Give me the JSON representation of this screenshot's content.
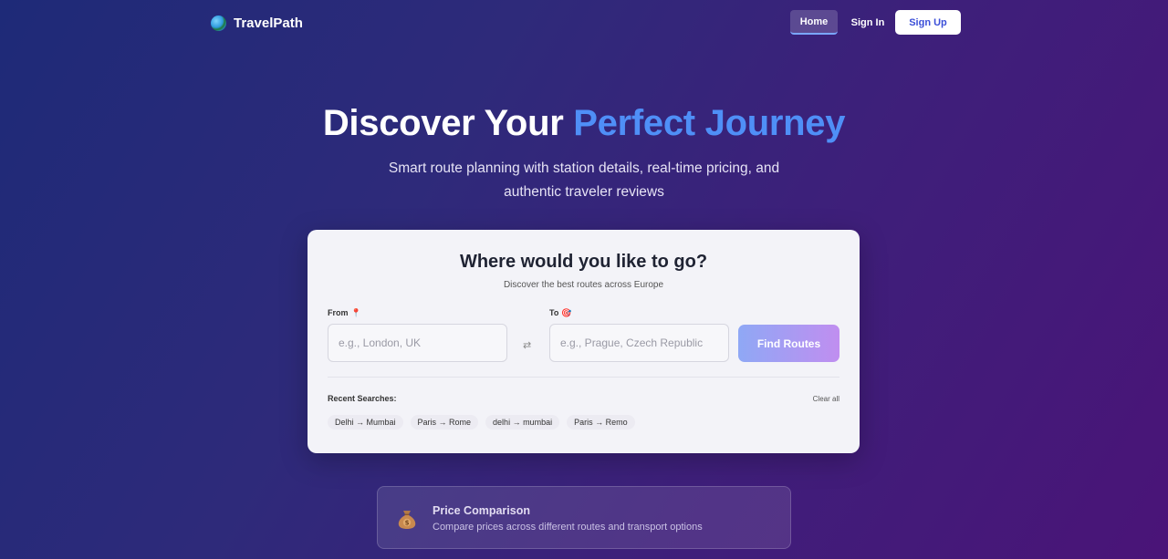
{
  "nav": {
    "brand": "TravelPath",
    "home": "Home",
    "sign_in": "Sign In",
    "sign_up": "Sign Up"
  },
  "hero": {
    "title_plain": "Discover Your",
    "title_accent": "Perfect Journey",
    "subtitle": "Smart route planning with station details, real-time pricing, and authentic traveler reviews"
  },
  "search": {
    "title": "Where would you like to go?",
    "subtitle": "Discover the best routes across Europe",
    "from_label": "From",
    "from_placeholder": "e.g., London, UK",
    "to_label": "To",
    "to_placeholder": "e.g., Prague, Czech Republic",
    "swap_icon": "⇄",
    "button": "Find Routes"
  },
  "recent": {
    "label": "Recent Searches:",
    "clear": "Clear all",
    "items": [
      "Delhi → Mumbai",
      "Paris → Rome",
      "delhi → mumbai",
      "Paris → Remo"
    ]
  },
  "feature": {
    "title": "Price Comparison",
    "description": "Compare prices across different routes and transport options",
    "icon": "money-bag-icon"
  },
  "colors": {
    "accent": "#4f8ff7",
    "signup_text": "#3b4fd8"
  }
}
